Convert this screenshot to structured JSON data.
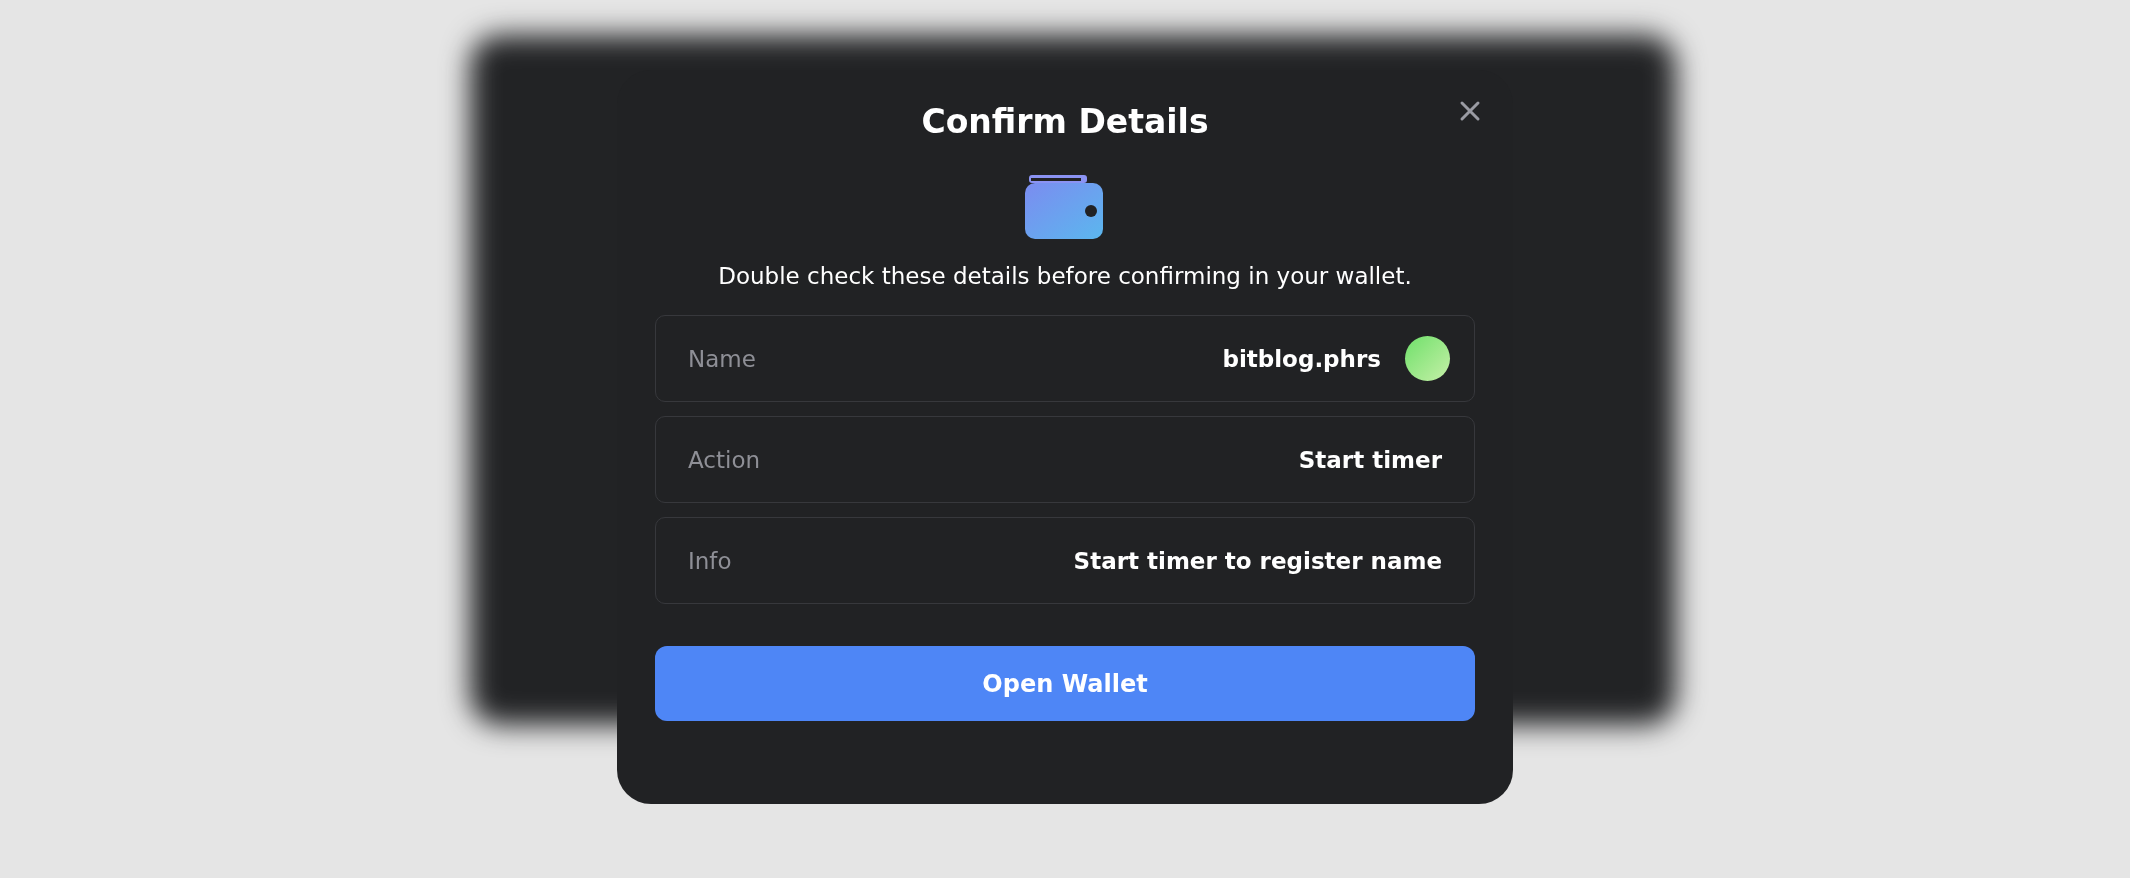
{
  "dialog": {
    "title": "Confirm Details",
    "description": "Double check these details before confirming in your wallet.",
    "rows": [
      {
        "kind": "avatar",
        "label": "Name",
        "value": "bitblog.phrs"
      },
      {
        "kind": "text",
        "label": "Action",
        "value": "Start timer"
      },
      {
        "kind": "text",
        "label": "Info",
        "value": "Start timer to register name"
      }
    ],
    "button": "Open Wallet"
  }
}
